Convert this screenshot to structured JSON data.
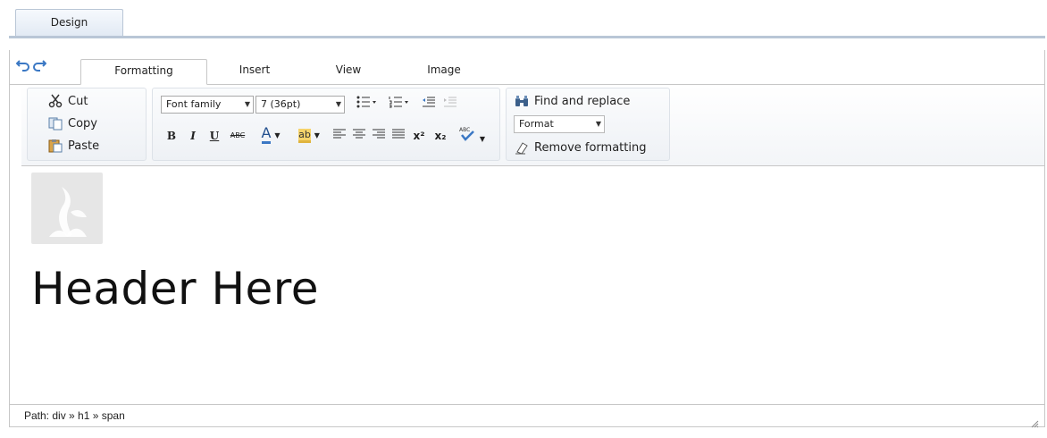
{
  "mode_tab": {
    "label": "Design"
  },
  "ribbon_tabs": [
    "Formatting",
    "Insert",
    "View",
    "Image"
  ],
  "clipboard": {
    "cut": "Cut",
    "copy": "Copy",
    "paste": "Paste"
  },
  "font": {
    "family_value": "Font family",
    "size_value": "7 (36pt)"
  },
  "text_tools": {
    "bold": "B",
    "italic": "I",
    "underline": "U",
    "strike": "ABC",
    "font_color": "A",
    "highlight": "ab",
    "superscript": "x²",
    "subscript": "x₂"
  },
  "editing": {
    "find_replace": "Find and replace",
    "format_value": "Format",
    "remove_formatting": "Remove formatting"
  },
  "content": {
    "heading": "Header Here"
  },
  "status": {
    "path": "Path: div » h1 » span"
  },
  "colors": {
    "accent": "#3b78c4",
    "border": "#c7c7c7",
    "tab_bar": "#b9c6d6"
  },
  "icons": [
    "undo-icon",
    "redo-icon",
    "cut-icon",
    "copy-icon",
    "paste-icon",
    "binoculars-icon",
    "eraser-icon",
    "spellcheck-icon",
    "image-placeholder-icon",
    "resize-grip-icon"
  ]
}
